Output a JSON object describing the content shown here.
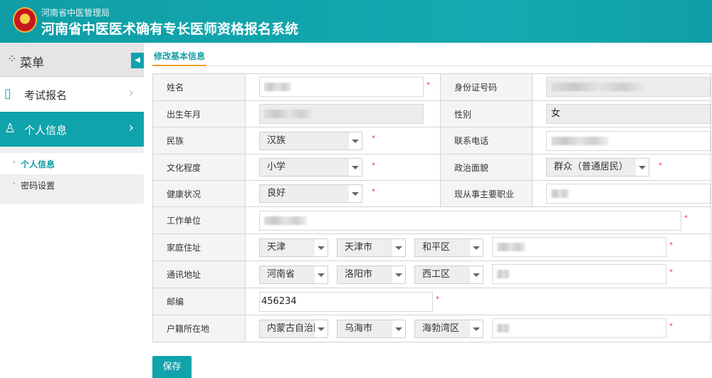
{
  "header": {
    "org": "河南省中医管理局",
    "title": "河南省中医医术确有专长医师资格报名系统"
  },
  "sidebar": {
    "menu_label": "菜单",
    "items": [
      {
        "label": "考试报名"
      },
      {
        "label": "个人信息"
      }
    ],
    "sub_items": [
      {
        "label": "个人信息"
      },
      {
        "label": "密码设置"
      }
    ]
  },
  "tab": "修改基本信息",
  "form": {
    "name_label": "姓名",
    "id_label": "身份证号码",
    "birth_label": "出生年月",
    "gender_label": "性别",
    "gender": "女",
    "ethnic_label": "民族",
    "ethnic": "汉族",
    "phone_label": "联系电话",
    "edu_label": "文化程度",
    "edu": "小学",
    "political_label": "政治面貌",
    "political": "群众（普通居民）",
    "health_label": "健康状况",
    "health": "良好",
    "occupation_label": "现从事主要职业",
    "work_label": "工作单位",
    "home_label": "家庭住址",
    "home": [
      "天津",
      "天津市",
      "和平区"
    ],
    "mail_label": "通讯地址",
    "mail": [
      "河南省",
      "洛阳市",
      "西工区"
    ],
    "postcode_label": "邮编",
    "postcode": "456234",
    "huji_label": "户籍所在地",
    "huji": [
      "内蒙古自治区",
      "乌海市",
      "海勃湾区"
    ],
    "required": "*"
  },
  "save_label": "保存"
}
